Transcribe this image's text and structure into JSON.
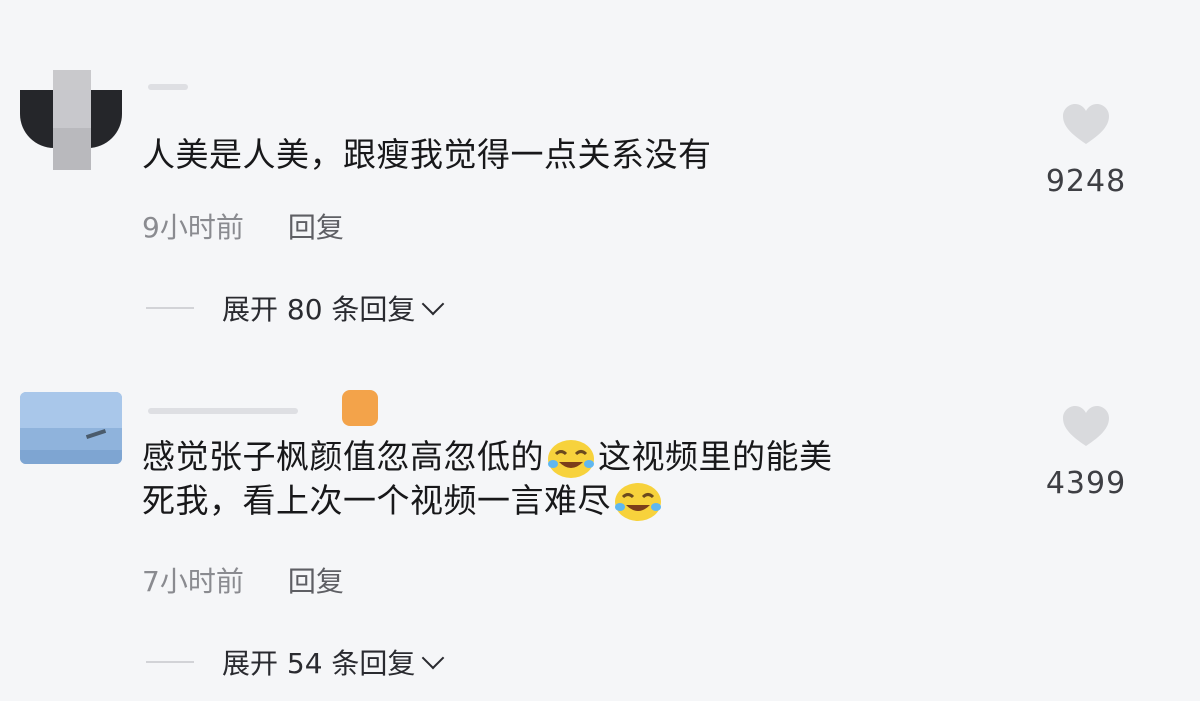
{
  "comments": [
    {
      "text": "人美是人美，跟瘦我觉得一点关系没有",
      "time": "9小时前",
      "reply_label": "回复",
      "expand_label": "展开 80 条回复",
      "likes": "9248"
    },
    {
      "text_part1": "感觉张子枫颜值忽高忽低的",
      "text_part2": "这视频里的能美",
      "text_part3": "死我，看上次一个视频一言难尽",
      "time": "7小时前",
      "reply_label": "回复",
      "expand_label": "展开 54 条回复",
      "likes": "4399",
      "emoji": "laughing-crying-emoji"
    }
  ],
  "icons": {
    "like": "heart-icon",
    "expand": "chevron-down-icon"
  },
  "colors": {
    "background": "#f5f6f8",
    "text": "#18181a",
    "meta": "#8a8b90",
    "heart": "#d9dadd"
  }
}
